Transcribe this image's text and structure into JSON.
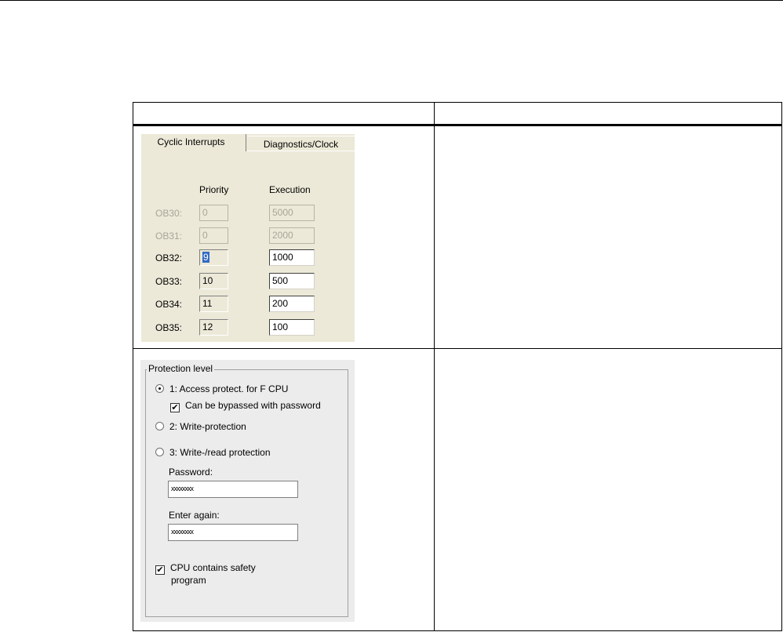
{
  "cyclic_panel": {
    "tabs": [
      "Cyclic Interrupts",
      "Diagnostics/Clock"
    ],
    "columns": {
      "priority": "Priority",
      "execution": "Execution"
    },
    "rows": [
      {
        "ob": "OB30:",
        "priority": "0",
        "execution": "5000"
      },
      {
        "ob": "OB31:",
        "priority": "0",
        "execution": "2000"
      },
      {
        "ob": "OB32:",
        "priority": "9",
        "execution": "1000"
      },
      {
        "ob": "OB33:",
        "priority": "10",
        "execution": "500"
      },
      {
        "ob": "OB34:",
        "priority": "11",
        "execution": "200"
      },
      {
        "ob": "OB35:",
        "priority": "12",
        "execution": "100"
      }
    ]
  },
  "protection_panel": {
    "group_title": "Protection level",
    "option1": "1: Access protect. for F CPU",
    "option1_sub": "Can be bypassed with password",
    "option2": "2: Write-protection",
    "option3": "3: Write-/read protection",
    "password_label": "Password:",
    "password_value": "xxxxxxxx",
    "enter_again_label": "Enter again:",
    "enter_again_value": "xxxxxxxx",
    "safety_line1": "CPU contains safety",
    "safety_line2": "program"
  }
}
